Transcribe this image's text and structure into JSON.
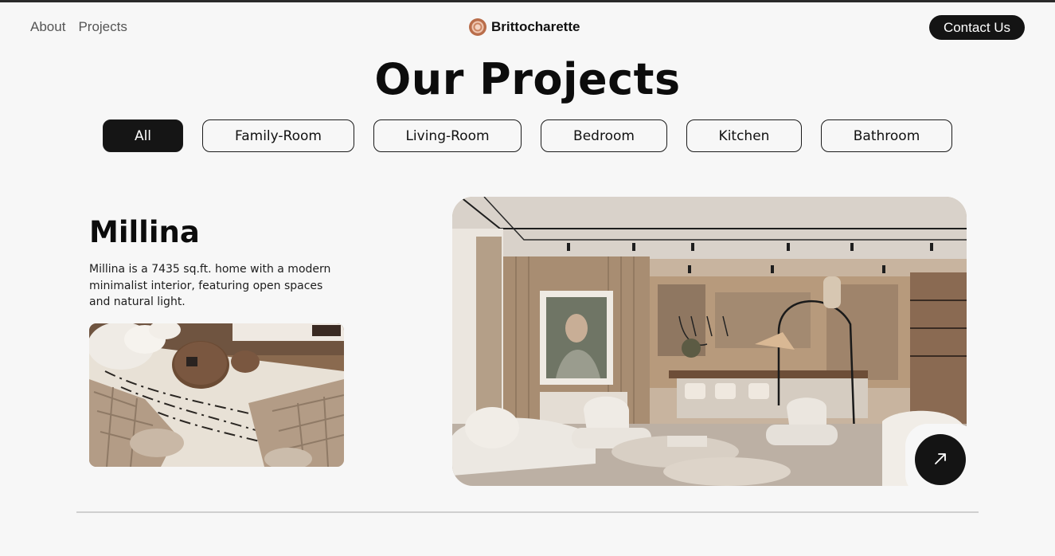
{
  "header": {
    "nav": [
      {
        "label": "About"
      },
      {
        "label": "Projects"
      }
    ],
    "brand": {
      "name": "Brittocharette",
      "logo_icon": "spiral-logo-icon"
    },
    "contact_label": "Contact Us"
  },
  "page": {
    "title": "Our Projects"
  },
  "filters": [
    {
      "label": "All",
      "active": true
    },
    {
      "label": "Family-Room",
      "active": false
    },
    {
      "label": "Living-Room",
      "active": false
    },
    {
      "label": "Bedroom",
      "active": false
    },
    {
      "label": "Kitchen",
      "active": false
    },
    {
      "label": "Bathroom",
      "active": false
    }
  ],
  "project": {
    "title": "Millina",
    "description": "Millina is a 7435 sq.ft. home with a modern minimalist interior, featuring open spaces and natural light.",
    "open_icon": "arrow-up-right-icon"
  },
  "colors": {
    "background": "#f7f7f7",
    "dark": "#141414",
    "divider": "#cfcfcf"
  }
}
